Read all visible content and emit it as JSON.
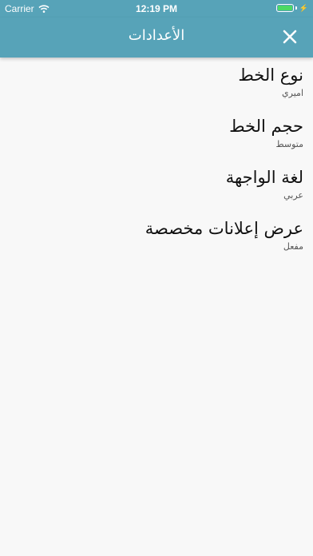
{
  "status_bar": {
    "carrier": "Carrier",
    "time": "12:19 PM",
    "battery_level": 1.0,
    "battery_color": "#4cd964"
  },
  "nav": {
    "title": "الأعدادات",
    "close_icon": "close-icon",
    "background_color": "#57a3b8"
  },
  "settings": [
    {
      "title": "نوع الخط",
      "value": "اميري"
    },
    {
      "title": "حجم الخط",
      "value": "متوسط"
    },
    {
      "title": "لغة الواجهة",
      "value": "عربي"
    },
    {
      "title": "عرض إعلانات مخصصة",
      "value": "مفعل"
    }
  ]
}
